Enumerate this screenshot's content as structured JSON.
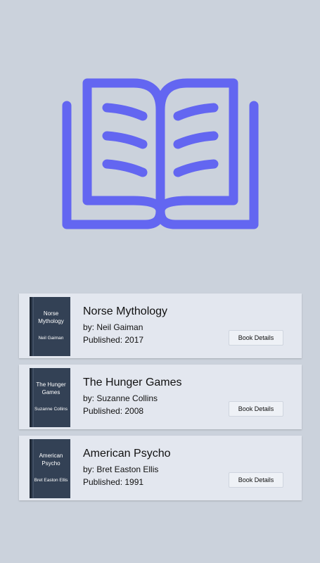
{
  "hero": {
    "icon": "open-book-icon",
    "accent_color": "#6366f1"
  },
  "books": [
    {
      "cover_title": "Norse Mythology",
      "cover_author": "Neil Gaiman",
      "title": "Norse Mythology",
      "author": "by: Neil Gaiman",
      "published": "Published: 2017",
      "button_label": "Book Details"
    },
    {
      "cover_title": "The Hunger Games",
      "cover_author": "Suzanne Collins",
      "title": "The Hunger Games",
      "author": "by: Suzanne Collins",
      "published": "Published: 2008",
      "button_label": "Book Details"
    },
    {
      "cover_title": "American Psycho",
      "cover_author": "Bret Easton Ellis",
      "title": "American Psycho",
      "author": "by: Bret Easton Ellis",
      "published": "Published: 1991",
      "button_label": "Book Details"
    }
  ],
  "colors": {
    "background": "#cbd2dc",
    "card": "#e3e7ef",
    "cover": "#334155"
  }
}
